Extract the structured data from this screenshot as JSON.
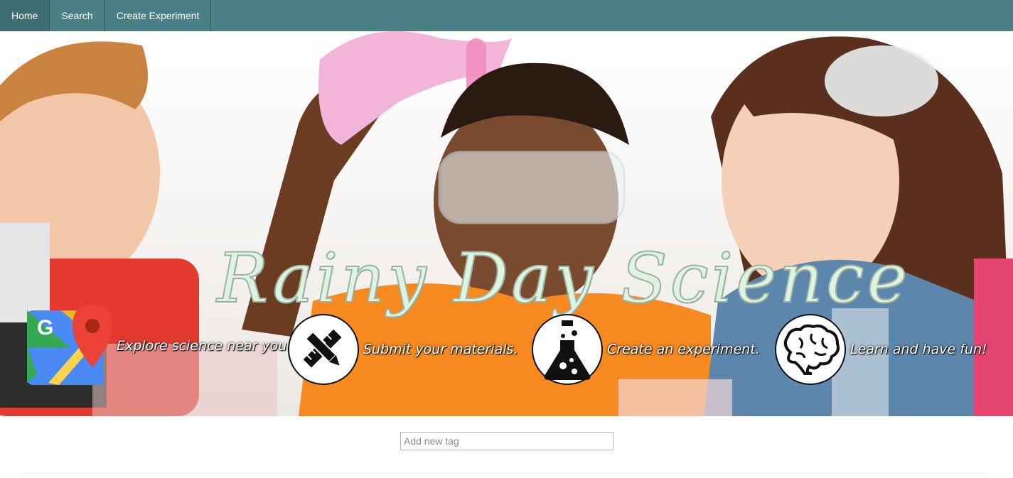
{
  "nav": {
    "items": [
      {
        "label": "Home"
      },
      {
        "label": "Search"
      },
      {
        "label": "Create Experiment"
      }
    ],
    "background": "#4a7f86"
  },
  "hero": {
    "title": "Rainy Day Science",
    "features": [
      {
        "label": "Explore science near you.",
        "icon": "google-maps-icon"
      },
      {
        "label": "Submit your materials.",
        "icon": "ruler-pencil-icon"
      },
      {
        "label": "Create an experiment.",
        "icon": "flask-icon"
      },
      {
        "label": "Learn and have fun!",
        "icon": "brain-icon"
      }
    ]
  },
  "tags": {
    "placeholder": "Add new tag"
  }
}
